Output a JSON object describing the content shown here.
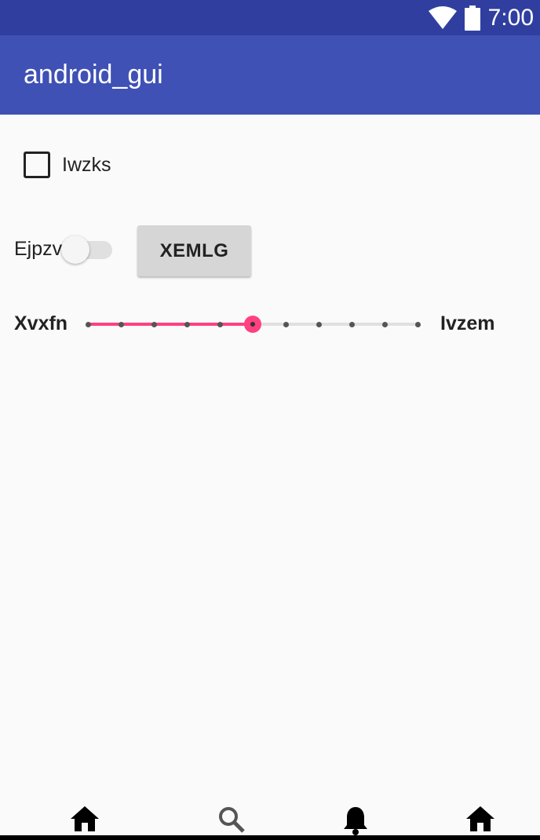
{
  "status_bar": {
    "time": "7:00",
    "icons": [
      "wifi-icon",
      "battery-icon"
    ]
  },
  "app_bar": {
    "title": "android_gui"
  },
  "checkbox": {
    "label": "Iwzks",
    "checked": false
  },
  "switch": {
    "label": "Ejpzv",
    "on": false
  },
  "button": {
    "label": "XEMLG"
  },
  "seekbar": {
    "left_label": "Xvxfn",
    "right_label": "Ivzem",
    "steps": 10,
    "value": 5,
    "accent_color": "#ff4081"
  },
  "bottom_nav": {
    "items": [
      "home-icon",
      "search-icon",
      "notifications-icon",
      "home-icon"
    ]
  },
  "colors": {
    "status_bar": "#303f9f",
    "app_bar": "#3f51b5",
    "background": "#fafafa"
  }
}
